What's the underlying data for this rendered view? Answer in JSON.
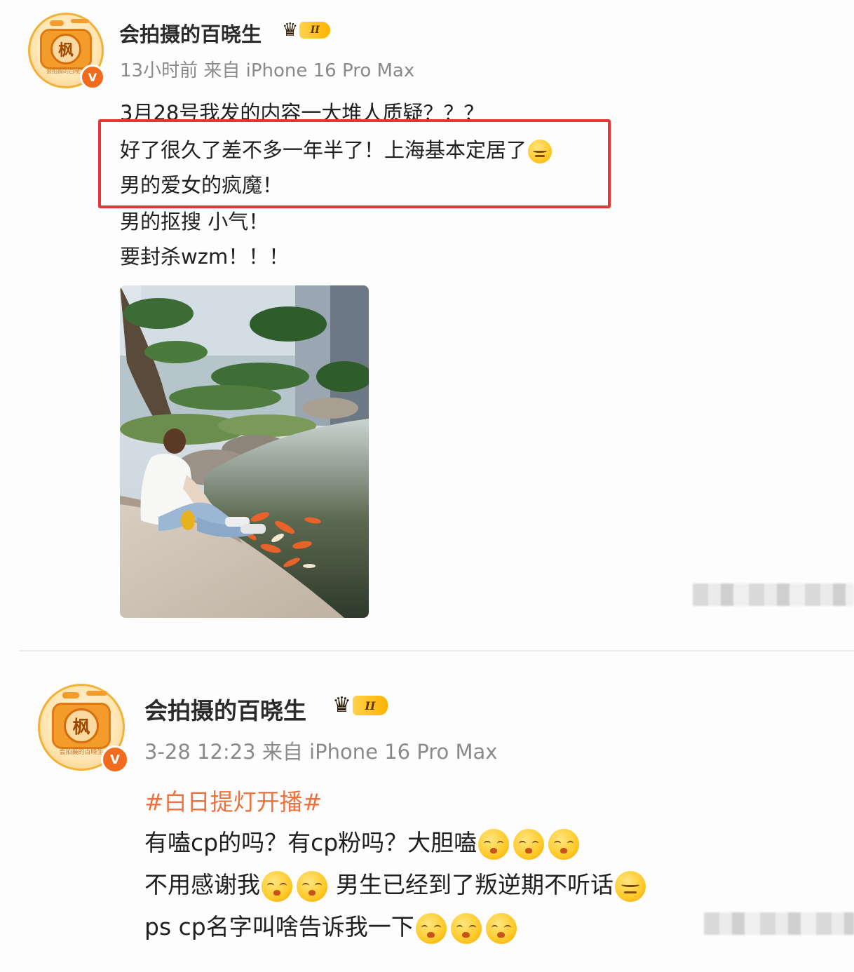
{
  "posts": [
    {
      "username": "会拍摄的百晓生",
      "avatar_char": "枫",
      "avatar_caption": "会拍摄的百晓生",
      "verified_mark": "V",
      "level": "II",
      "meta": "13小时前 来自 iPhone 16 Pro Max",
      "lines": [
        "3月28号我发的内容一大堆人质疑？？？",
        "好了很久了差不多一年半了！上海基本定居了",
        "男的爱女的疯魔！",
        "男的抠搜 小气！",
        "要封杀wzm！！！"
      ],
      "image_icon": "photo-man-by-koi-pond"
    },
    {
      "username": "会拍摄的百晓生",
      "avatar_char": "枫",
      "avatar_caption": "会拍摄的百晓生",
      "verified_mark": "V",
      "level": "II",
      "meta": "3-28 12:23 来自 iPhone 16 Pro Max",
      "topic": "#白日提灯开播#",
      "lines": [
        "有嗑cp的吗？有cp粉吗？大胆嗑",
        "不用感谢我",
        "男生已经到了叛逆期不听话",
        "ps cp名字叫啥告诉我一下"
      ]
    }
  ],
  "colors": {
    "highlight_border": "#e53535",
    "topic": "#eb7340",
    "verified": "#f26b1d",
    "meta": "#8a8a8a"
  }
}
